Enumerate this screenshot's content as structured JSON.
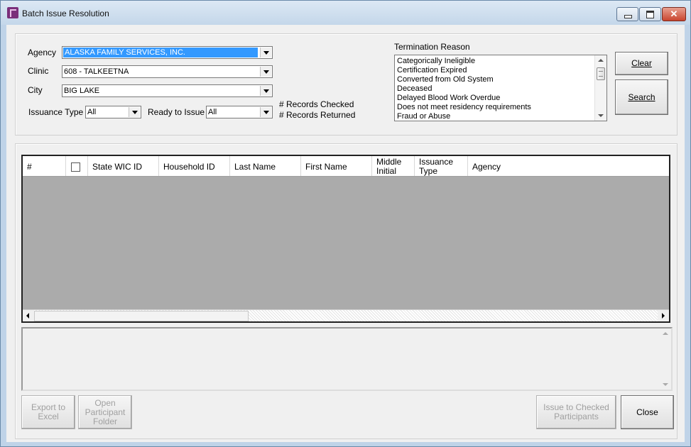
{
  "window": {
    "title": "Batch Issue Resolution",
    "controls": {
      "minimize": "minimize",
      "maximize": "maximize",
      "close": "✕"
    }
  },
  "filters": {
    "agency_label": "Agency",
    "agency_value": "ALASKA FAMILY SERVICES, INC.",
    "clinic_label": "Clinic",
    "clinic_value": "608 - TALKEETNA",
    "city_label": "City",
    "city_value": "BIG LAKE",
    "issuance_type_label": "Issuance Type",
    "issuance_type_value": "All",
    "ready_label": "Ready to Issue",
    "ready_value": "All",
    "records_checked": "# Records Checked",
    "records_returned": "# Records Returned"
  },
  "termination": {
    "label": "Termination Reason",
    "items": [
      "Categorically Ineligible",
      "Certification Expired",
      "Converted from Old System",
      "Deceased",
      "Delayed Blood Work Overdue",
      "Does not meet residency requirements",
      "Fraud or Abuse"
    ]
  },
  "buttons": {
    "clear": "Clear",
    "search": "Search",
    "export_line1": "Export to",
    "export_line2": "Excel",
    "open_line1": "Open",
    "open_line2": "Participant",
    "open_line3": "Folder",
    "issue_line1": "Issue to Checked",
    "issue_line2": "Participants",
    "close": "Close"
  },
  "grid": {
    "columns": {
      "num": "#",
      "state_wic_id": "State WIC ID",
      "household_id": "Household ID",
      "last_name": "Last Name",
      "first_name": "First Name",
      "middle_initial": "Middle Initial",
      "issuance_type": "Issuance Type",
      "agency": "Agency"
    }
  },
  "colors": {
    "selection": "#3399ff",
    "grid_background": "#ababab",
    "window_face": "#f0f0f0"
  }
}
